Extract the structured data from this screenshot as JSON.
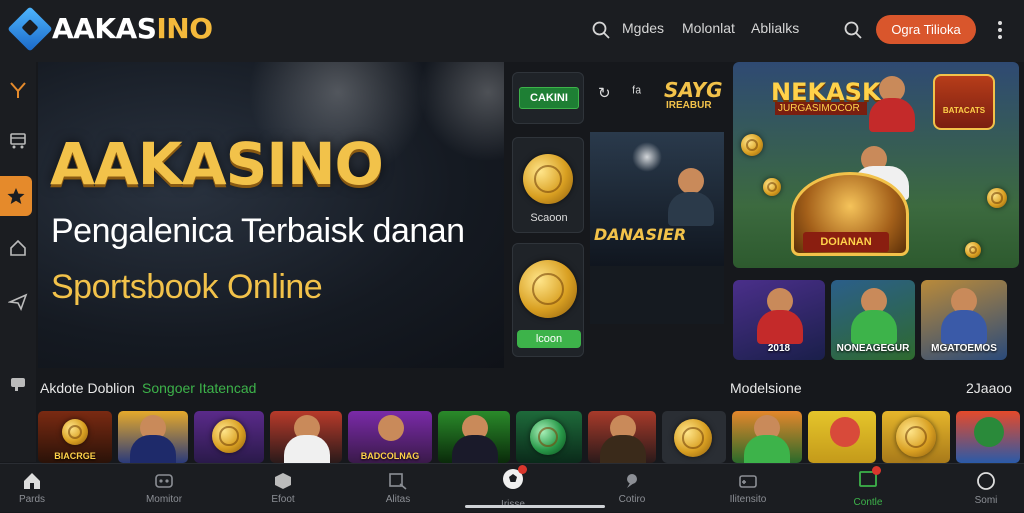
{
  "header": {
    "logo_text": "AAKASINO",
    "nav": [
      "Mgdes",
      "Molonlat",
      "Ablialks"
    ],
    "cta_label": "Ogra Tilioka"
  },
  "sidebar": {
    "items": [
      {
        "icon": "fork-icon"
      },
      {
        "icon": "cart-icon"
      },
      {
        "icon": "star-icon",
        "active": true
      },
      {
        "icon": "home-icon"
      },
      {
        "icon": "plane-icon"
      },
      {
        "icon": "chat-icon"
      }
    ]
  },
  "hero": {
    "title": "AAKASINO",
    "subtitle_line1": "Pengalenica Terbaisk danan",
    "subtitle_line2": "Sportsbook Online"
  },
  "middle": {
    "logo_card_text": "CAKINI",
    "coin_card_label": "Scaoon",
    "coin_card2_button": "lcoon",
    "right_logo_text": "SAYG",
    "right_logo_sub": "IREABUR",
    "promo_label": "DANASIER"
  },
  "banner": {
    "title": "NEKASK",
    "subtitle": "JURGASIMOCOR",
    "badge_text": "BATACATS",
    "wheel_label": "DOIANAN"
  },
  "game_tiles": [
    {
      "label": "2018"
    },
    {
      "label": "NONEAGEGUR"
    },
    {
      "label": "MGATOEMOS"
    }
  ],
  "sections": {
    "left_title": "Akdote Doblion",
    "left_highlight": "Songoer Itatencad",
    "right_title": "Modelsione",
    "right_count": "2Jaaoo"
  },
  "strip": [
    {
      "label": "BIACRGE"
    },
    {
      "label": ""
    },
    {
      "label": ""
    },
    {
      "label": ""
    },
    {
      "label": "BADCOLNAG"
    },
    {
      "label": ""
    },
    {
      "label": ""
    },
    {
      "label": ""
    },
    {
      "label": ""
    },
    {
      "label": ""
    },
    {
      "label": ""
    },
    {
      "label": ""
    },
    {
      "label": ""
    }
  ],
  "bottom_nav": [
    {
      "label": "Pards",
      "icon": "home-icon"
    },
    {
      "label": "Momitor",
      "icon": "joystick-icon"
    },
    {
      "label": "Efoot",
      "icon": "box-icon"
    },
    {
      "label": "Alitas",
      "icon": "search-icon"
    },
    {
      "label": "Irisse",
      "icon": "soccer-ball-icon"
    },
    {
      "label": "Cotiro",
      "icon": "chat-icon"
    },
    {
      "label": "Ilitensito",
      "icon": "gamepad-icon"
    },
    {
      "label": "Contle",
      "icon": "tablet-icon"
    },
    {
      "label": "Somi",
      "icon": "circle-icon"
    }
  ],
  "colors": {
    "accent": "#d9562c",
    "gold": "#f2c24a",
    "green": "#3db34a",
    "sidebar_active": "#e58a2b"
  }
}
